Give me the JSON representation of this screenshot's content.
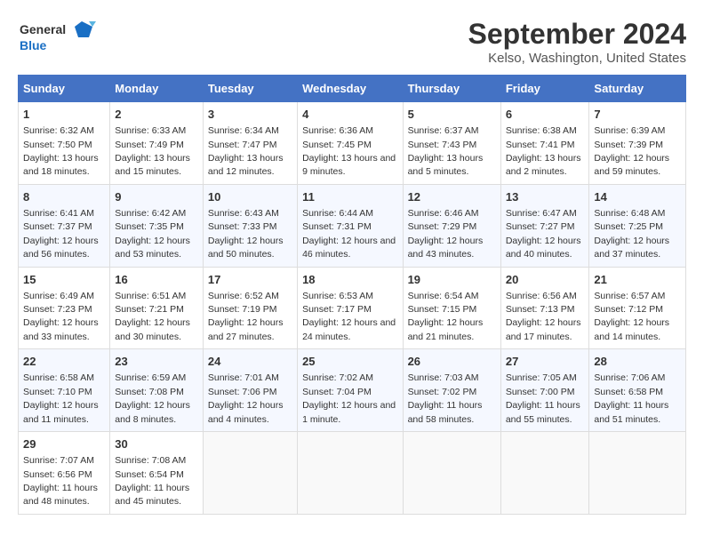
{
  "logo": {
    "line1": "General",
    "line2": "Blue"
  },
  "title": "September 2024",
  "subtitle": "Kelso, Washington, United States",
  "headers": [
    "Sunday",
    "Monday",
    "Tuesday",
    "Wednesday",
    "Thursday",
    "Friday",
    "Saturday"
  ],
  "weeks": [
    [
      {
        "day": "1",
        "sunrise": "6:32 AM",
        "sunset": "7:50 PM",
        "daylight": "13 hours and 18 minutes."
      },
      {
        "day": "2",
        "sunrise": "6:33 AM",
        "sunset": "7:49 PM",
        "daylight": "13 hours and 15 minutes."
      },
      {
        "day": "3",
        "sunrise": "6:34 AM",
        "sunset": "7:47 PM",
        "daylight": "13 hours and 12 minutes."
      },
      {
        "day": "4",
        "sunrise": "6:36 AM",
        "sunset": "7:45 PM",
        "daylight": "13 hours and 9 minutes."
      },
      {
        "day": "5",
        "sunrise": "6:37 AM",
        "sunset": "7:43 PM",
        "daylight": "13 hours and 5 minutes."
      },
      {
        "day": "6",
        "sunrise": "6:38 AM",
        "sunset": "7:41 PM",
        "daylight": "13 hours and 2 minutes."
      },
      {
        "day": "7",
        "sunrise": "6:39 AM",
        "sunset": "7:39 PM",
        "daylight": "12 hours and 59 minutes."
      }
    ],
    [
      {
        "day": "8",
        "sunrise": "6:41 AM",
        "sunset": "7:37 PM",
        "daylight": "12 hours and 56 minutes."
      },
      {
        "day": "9",
        "sunrise": "6:42 AM",
        "sunset": "7:35 PM",
        "daylight": "12 hours and 53 minutes."
      },
      {
        "day": "10",
        "sunrise": "6:43 AM",
        "sunset": "7:33 PM",
        "daylight": "12 hours and 50 minutes."
      },
      {
        "day": "11",
        "sunrise": "6:44 AM",
        "sunset": "7:31 PM",
        "daylight": "12 hours and 46 minutes."
      },
      {
        "day": "12",
        "sunrise": "6:46 AM",
        "sunset": "7:29 PM",
        "daylight": "12 hours and 43 minutes."
      },
      {
        "day": "13",
        "sunrise": "6:47 AM",
        "sunset": "7:27 PM",
        "daylight": "12 hours and 40 minutes."
      },
      {
        "day": "14",
        "sunrise": "6:48 AM",
        "sunset": "7:25 PM",
        "daylight": "12 hours and 37 minutes."
      }
    ],
    [
      {
        "day": "15",
        "sunrise": "6:49 AM",
        "sunset": "7:23 PM",
        "daylight": "12 hours and 33 minutes."
      },
      {
        "day": "16",
        "sunrise": "6:51 AM",
        "sunset": "7:21 PM",
        "daylight": "12 hours and 30 minutes."
      },
      {
        "day": "17",
        "sunrise": "6:52 AM",
        "sunset": "7:19 PM",
        "daylight": "12 hours and 27 minutes."
      },
      {
        "day": "18",
        "sunrise": "6:53 AM",
        "sunset": "7:17 PM",
        "daylight": "12 hours and 24 minutes."
      },
      {
        "day": "19",
        "sunrise": "6:54 AM",
        "sunset": "7:15 PM",
        "daylight": "12 hours and 21 minutes."
      },
      {
        "day": "20",
        "sunrise": "6:56 AM",
        "sunset": "7:13 PM",
        "daylight": "12 hours and 17 minutes."
      },
      {
        "day": "21",
        "sunrise": "6:57 AM",
        "sunset": "7:12 PM",
        "daylight": "12 hours and 14 minutes."
      }
    ],
    [
      {
        "day": "22",
        "sunrise": "6:58 AM",
        "sunset": "7:10 PM",
        "daylight": "12 hours and 11 minutes."
      },
      {
        "day": "23",
        "sunrise": "6:59 AM",
        "sunset": "7:08 PM",
        "daylight": "12 hours and 8 minutes."
      },
      {
        "day": "24",
        "sunrise": "7:01 AM",
        "sunset": "7:06 PM",
        "daylight": "12 hours and 4 minutes."
      },
      {
        "day": "25",
        "sunrise": "7:02 AM",
        "sunset": "7:04 PM",
        "daylight": "12 hours and 1 minute."
      },
      {
        "day": "26",
        "sunrise": "7:03 AM",
        "sunset": "7:02 PM",
        "daylight": "11 hours and 58 minutes."
      },
      {
        "day": "27",
        "sunrise": "7:05 AM",
        "sunset": "7:00 PM",
        "daylight": "11 hours and 55 minutes."
      },
      {
        "day": "28",
        "sunrise": "7:06 AM",
        "sunset": "6:58 PM",
        "daylight": "11 hours and 51 minutes."
      }
    ],
    [
      {
        "day": "29",
        "sunrise": "7:07 AM",
        "sunset": "6:56 PM",
        "daylight": "11 hours and 48 minutes."
      },
      {
        "day": "30",
        "sunrise": "7:08 AM",
        "sunset": "6:54 PM",
        "daylight": "11 hours and 45 minutes."
      },
      null,
      null,
      null,
      null,
      null
    ]
  ],
  "labels": {
    "sunrise": "Sunrise:",
    "sunset": "Sunset:",
    "daylight": "Daylight:"
  }
}
